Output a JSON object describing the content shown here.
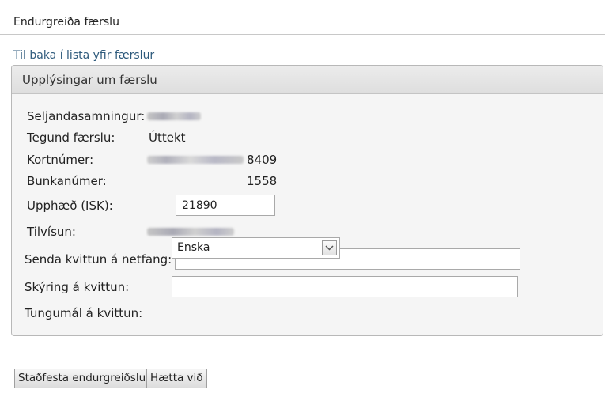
{
  "tabs": [
    {
      "label": "Endurgreiða færslu"
    }
  ],
  "back_link": "Til baka í lista yfir færslur",
  "panel": {
    "title": "Upplýsingar um færslu",
    "fields": {
      "merchant_agreement": {
        "label": "Seljandasamningur:"
      },
      "transaction_type": {
        "label": "Tegund færslu:",
        "value": "Úttekt"
      },
      "card_number": {
        "label": "Kortnúmer:",
        "last4": "8409"
      },
      "batch_number": {
        "label": "Bunkanúmer:",
        "value": "1558"
      },
      "amount": {
        "label": "Upphæð (ISK):",
        "value": "21890"
      },
      "reference": {
        "label": "Tilvísun:"
      },
      "receipt_email": {
        "label": "Senda kvittun á netfang:",
        "value": ""
      },
      "receipt_note": {
        "label": "Skýring á kvittun:",
        "value": ""
      },
      "receipt_language": {
        "label": "Tungumál á kvittun:",
        "value": "Enska"
      }
    }
  },
  "buttons": {
    "confirm": "Staðfesta endurgreiðslu",
    "cancel": "Hætta við"
  },
  "icons": {
    "dropdown": "chevron-down-icon"
  },
  "colors": {
    "link": "#2e5a7c",
    "panel_bg": "#f5f5f5",
    "header_bg": "#e3e3e3"
  }
}
